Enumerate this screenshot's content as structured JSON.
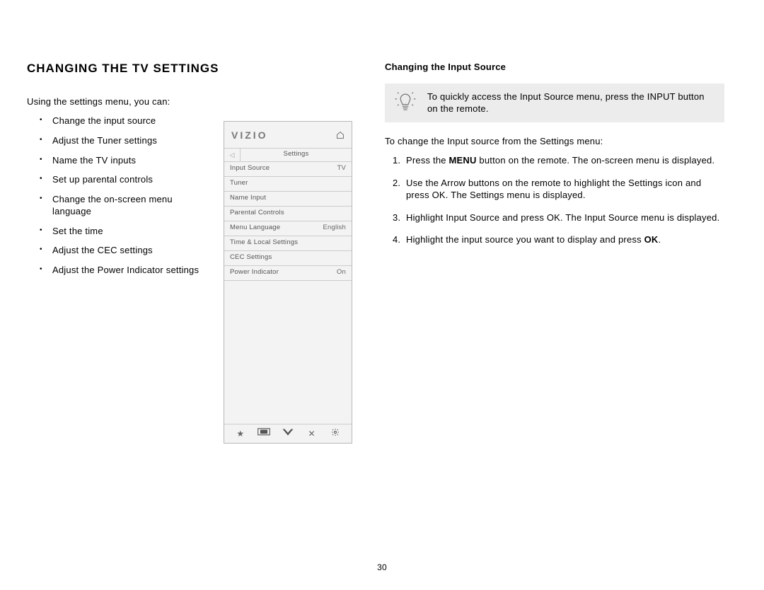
{
  "page_number": "30",
  "left": {
    "heading": "CHANGING THE TV SETTINGS",
    "intro": "Using the settings menu, you can:",
    "bullets": [
      "Change the input source",
      "Adjust the Tuner settings",
      "Name the TV inputs",
      "Set up parental controls",
      "Change the on-screen menu language",
      "Set the time",
      "Adjust the CEC settings",
      "Adjust the Power Indicator settings"
    ]
  },
  "menu": {
    "brand": "VIZIO",
    "breadcrumb": "Settings",
    "rows": [
      {
        "label": "Input Source",
        "value": "TV"
      },
      {
        "label": "Tuner",
        "value": ""
      },
      {
        "label": "Name Input",
        "value": ""
      },
      {
        "label": "Parental Controls",
        "value": ""
      },
      {
        "label": "Menu Language",
        "value": "English"
      },
      {
        "label": "Time & Local Settings",
        "value": ""
      },
      {
        "label": "CEC Settings",
        "value": ""
      },
      {
        "label": "Power Indicator",
        "value": "On"
      }
    ],
    "footer_icons": [
      "star-icon",
      "wide-icon",
      "v-icon",
      "close-icon",
      "gear-icon"
    ]
  },
  "right": {
    "heading": "Changing the Input Source",
    "tip": "To quickly access the Input Source menu, press the INPUT button on the remote.",
    "lead": "To change the Input source from the Settings menu:",
    "steps": [
      {
        "pre": "Press the ",
        "bold": "MENU",
        "post": " button on the remote. The on-screen menu is displayed."
      },
      {
        "pre": "Use the Arrow buttons on the remote to highlight the Settings icon and press OK. The Settings menu is displayed.",
        "bold": "",
        "post": ""
      },
      {
        "pre": "Highlight Input Source and press OK. The Input Source menu is displayed.",
        "bold": "",
        "post": ""
      },
      {
        "pre": "Highlight the input source you want to display and press ",
        "bold": "OK",
        "post": "."
      }
    ]
  }
}
